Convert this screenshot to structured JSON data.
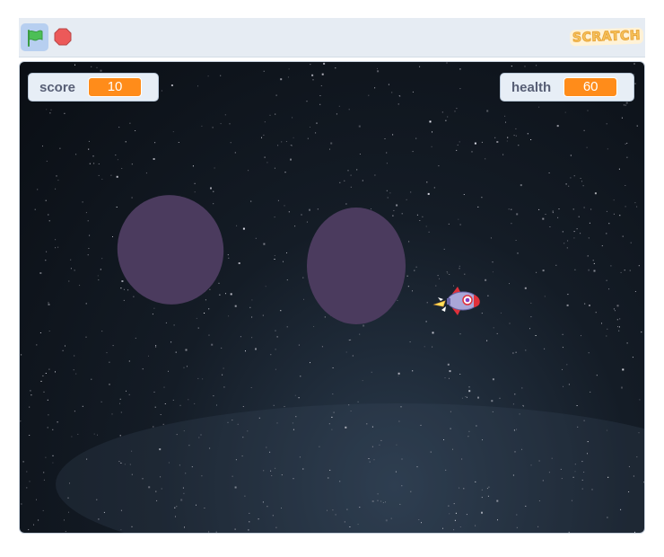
{
  "toolbar": {
    "flag_icon": "green-flag-icon",
    "stop_icon": "stop-sign-icon",
    "logo_text": "SCRATCH"
  },
  "stage": {
    "background": "starfield",
    "monitors": {
      "score": {
        "label": "score",
        "value": "10"
      },
      "health": {
        "label": "health",
        "value": "60"
      }
    },
    "sprites": [
      "asteroid",
      "asteroid",
      "rocket-ship"
    ]
  },
  "colors": {
    "monitor_value_bg": "#ff8c1a",
    "asteroid": "#4b3b5e",
    "toolbar_bg": "#e6ecf3",
    "flag_green": "#4cbf56",
    "stop_red": "#ec5959"
  }
}
